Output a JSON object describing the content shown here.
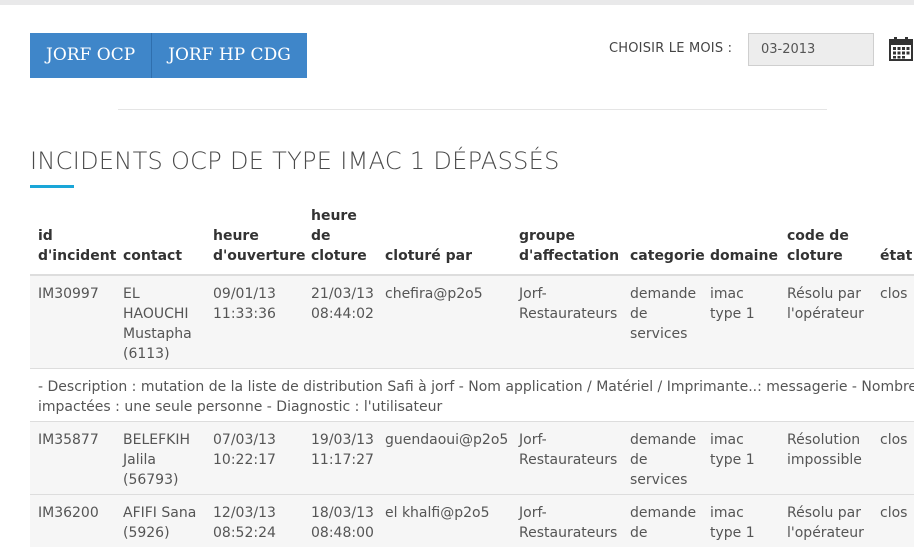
{
  "tabs": [
    "JORF OCP",
    "JORF HP CDG"
  ],
  "month_picker": {
    "label": "CHOISIR LE MOIS :",
    "value": "03-2013",
    "icon": "calendar-icon"
  },
  "title": "INCIDENTS OCP DE TYPE IMAC 1 DÉPASSÉS",
  "table": {
    "headers": [
      [
        "id",
        "d'incident"
      ],
      [
        "contact"
      ],
      [
        "heure",
        "d'ouverture"
      ],
      [
        "heure",
        "de",
        "cloture"
      ],
      [
        "cloturé par"
      ],
      [
        "groupe",
        "d'affectation"
      ],
      [
        "categorie"
      ],
      [
        "domaine"
      ],
      [
        "code de",
        "cloture"
      ],
      [
        "état"
      ]
    ],
    "rows": [
      {
        "id": "IM30997",
        "contact": [
          "EL",
          "HAOUCHI",
          "Mustapha",
          "(6113)"
        ],
        "ouverture": [
          "09/01/13",
          "11:33:36"
        ],
        "cloture": [
          "21/03/13",
          "08:44:02"
        ],
        "cloture_par": "chefira@p2o5",
        "groupe": [
          "Jorf-",
          "Restaurateurs"
        ],
        "categorie": [
          "demande",
          "de",
          "services"
        ],
        "domaine": [
          "imac",
          "type 1"
        ],
        "code": [
          "Résolu par",
          "l'opérateur"
        ],
        "etat": "clos",
        "description": [
          "- Description : mutation de la liste de distribution Safi à jorf - Nom application / Matériel / Imprimante..: messagerie - Nombre personnes",
          "impactées : une seule personne - Diagnostic : l'utilisateur"
        ]
      },
      {
        "id": "IM35877",
        "contact": [
          "BELEFKIH",
          "Jalila",
          "(56793)"
        ],
        "ouverture": [
          "07/03/13",
          "10:22:17"
        ],
        "cloture": [
          "19/03/13",
          "11:17:27"
        ],
        "cloture_par": "guendaoui@p2o5",
        "groupe": [
          "Jorf-",
          "Restaurateurs"
        ],
        "categorie": [
          "demande",
          "de",
          "services"
        ],
        "domaine": [
          "imac",
          "type 1"
        ],
        "code": [
          "Résolution",
          "impossible"
        ],
        "etat": "clos"
      },
      {
        "id": "IM36200",
        "contact": [
          "AFIFI Sana",
          "(5926)"
        ],
        "ouverture": [
          "12/03/13",
          "08:52:24"
        ],
        "cloture": [
          "18/03/13",
          "08:48:00"
        ],
        "cloture_par": "el khalfi@p2o5",
        "groupe": [
          "Jorf-",
          "Restaurateurs"
        ],
        "categorie": [
          "demande",
          "de"
        ],
        "domaine": [
          "imac",
          "type 1"
        ],
        "code": [
          "Résolu par",
          "l'opérateur"
        ],
        "etat": "clos"
      }
    ]
  }
}
